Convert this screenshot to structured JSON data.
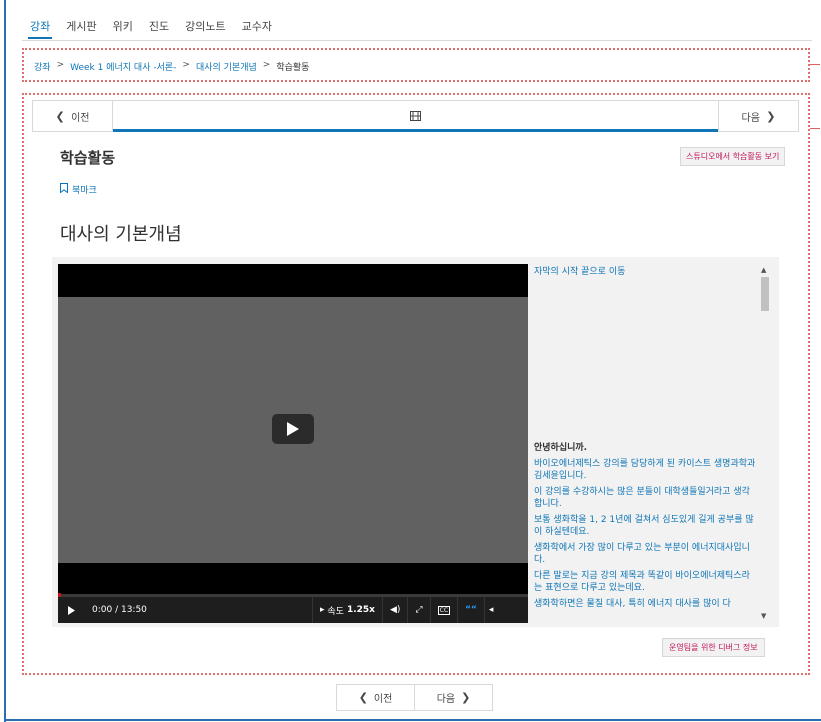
{
  "tabs": [
    "강좌",
    "게시판",
    "위키",
    "진도",
    "강의노트",
    "교수자"
  ],
  "breadcrumb": {
    "items": [
      "강좌",
      "Week 1 에너지 대사 -서론-",
      "대사의 기본개념"
    ],
    "current": "학습활동",
    "separator": ">"
  },
  "seq_nav": {
    "prev": "이전",
    "next": "다음",
    "icon": "film-icon"
  },
  "unit": {
    "title": "학습활동",
    "studio_button": "스튜디오에서 학습활동 보기",
    "bookmark": "북마크",
    "content_title": "대사의 기본개념"
  },
  "video": {
    "time": "0:00 / 13:50",
    "speed_label": "속도",
    "speed_value": "1.25x",
    "progress_fraction": 0
  },
  "transcript": {
    "skip_link": "자막의 시작 끝으로 이동",
    "lines": [
      "안녕하십니까.",
      "바이오에너제틱스 강의를 담당하게 된 카이스트 생명과학과 김세윤입니다.",
      "이 강의를 수강하시는 많은 분들이 대학생들일거라고 생각합니다.",
      "보통 생화학을 1, 2 1년에 걸쳐서 심도있게 길게 공부를 많이 하실텐데요.",
      "생화학에서 가장 많이 다루고 있는 부분이 에너지대사입니다.",
      "다른 말로는 지금 강의 제목과 똑같이 바이오에너제틱스라는 표현으로 다루고 있는데요.",
      "생화학하면은 물질 대사, 특히 에너지 대사를 많이 다"
    ]
  },
  "debug_button": "운영팀을 위한 디버그 정보",
  "bottom_nav": {
    "prev": "이전",
    "next": "다음"
  },
  "colors": {
    "accent": "#0e75b6",
    "link_pink": "#c2185b",
    "dotted_red": "#e07070"
  }
}
